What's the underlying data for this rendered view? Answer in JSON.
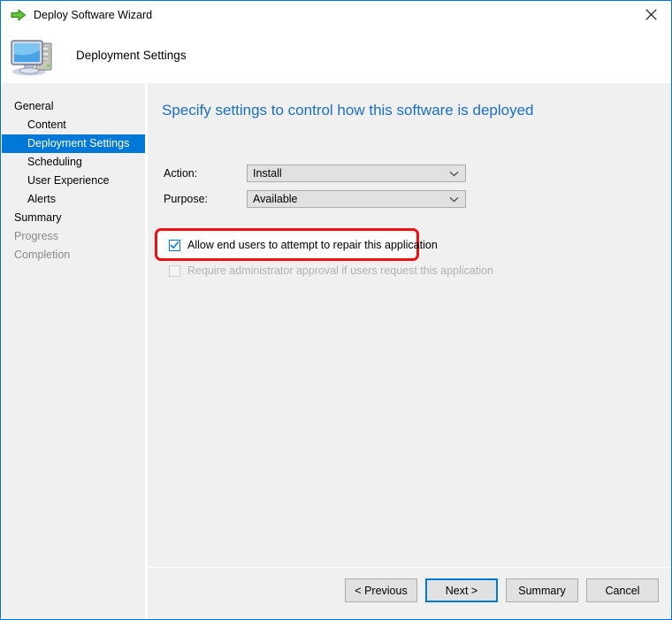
{
  "window": {
    "title": "Deploy Software Wizard",
    "title_icon": "green-arrow-icon",
    "close_icon": "close-icon",
    "accent_color": "#0078d7",
    "annotation_color": "#ee1111"
  },
  "header": {
    "icon": "computer-icon",
    "title": "Deployment Settings"
  },
  "sidebar": {
    "items": [
      {
        "label": "General",
        "level": 0,
        "selected": false,
        "disabled": false
      },
      {
        "label": "Content",
        "level": 1,
        "selected": false,
        "disabled": false
      },
      {
        "label": "Deployment Settings",
        "level": 1,
        "selected": true,
        "disabled": false
      },
      {
        "label": "Scheduling",
        "level": 1,
        "selected": false,
        "disabled": false
      },
      {
        "label": "User Experience",
        "level": 1,
        "selected": false,
        "disabled": false
      },
      {
        "label": "Alerts",
        "level": 1,
        "selected": false,
        "disabled": false
      },
      {
        "label": "Summary",
        "level": 0,
        "selected": false,
        "disabled": false
      },
      {
        "label": "Progress",
        "level": 0,
        "selected": false,
        "disabled": true
      },
      {
        "label": "Completion",
        "level": 0,
        "selected": false,
        "disabled": true
      }
    ]
  },
  "content": {
    "heading": "Specify settings to control how this software is deployed",
    "fields": [
      {
        "label": "Action:",
        "value": "Install"
      },
      {
        "label": "Purpose:",
        "value": "Available"
      }
    ],
    "checkboxes": [
      {
        "label": "Allow end users to attempt to repair this application",
        "checked": true,
        "disabled": false,
        "highlighted": true
      },
      {
        "label": "Require administrator approval if users request this application",
        "checked": false,
        "disabled": true,
        "highlighted": false
      }
    ]
  },
  "footer": {
    "buttons": [
      {
        "label": "< Previous",
        "default": false
      },
      {
        "label": "Next >",
        "default": true
      },
      {
        "label": "Summary",
        "default": false
      },
      {
        "label": "Cancel",
        "default": false
      }
    ]
  }
}
